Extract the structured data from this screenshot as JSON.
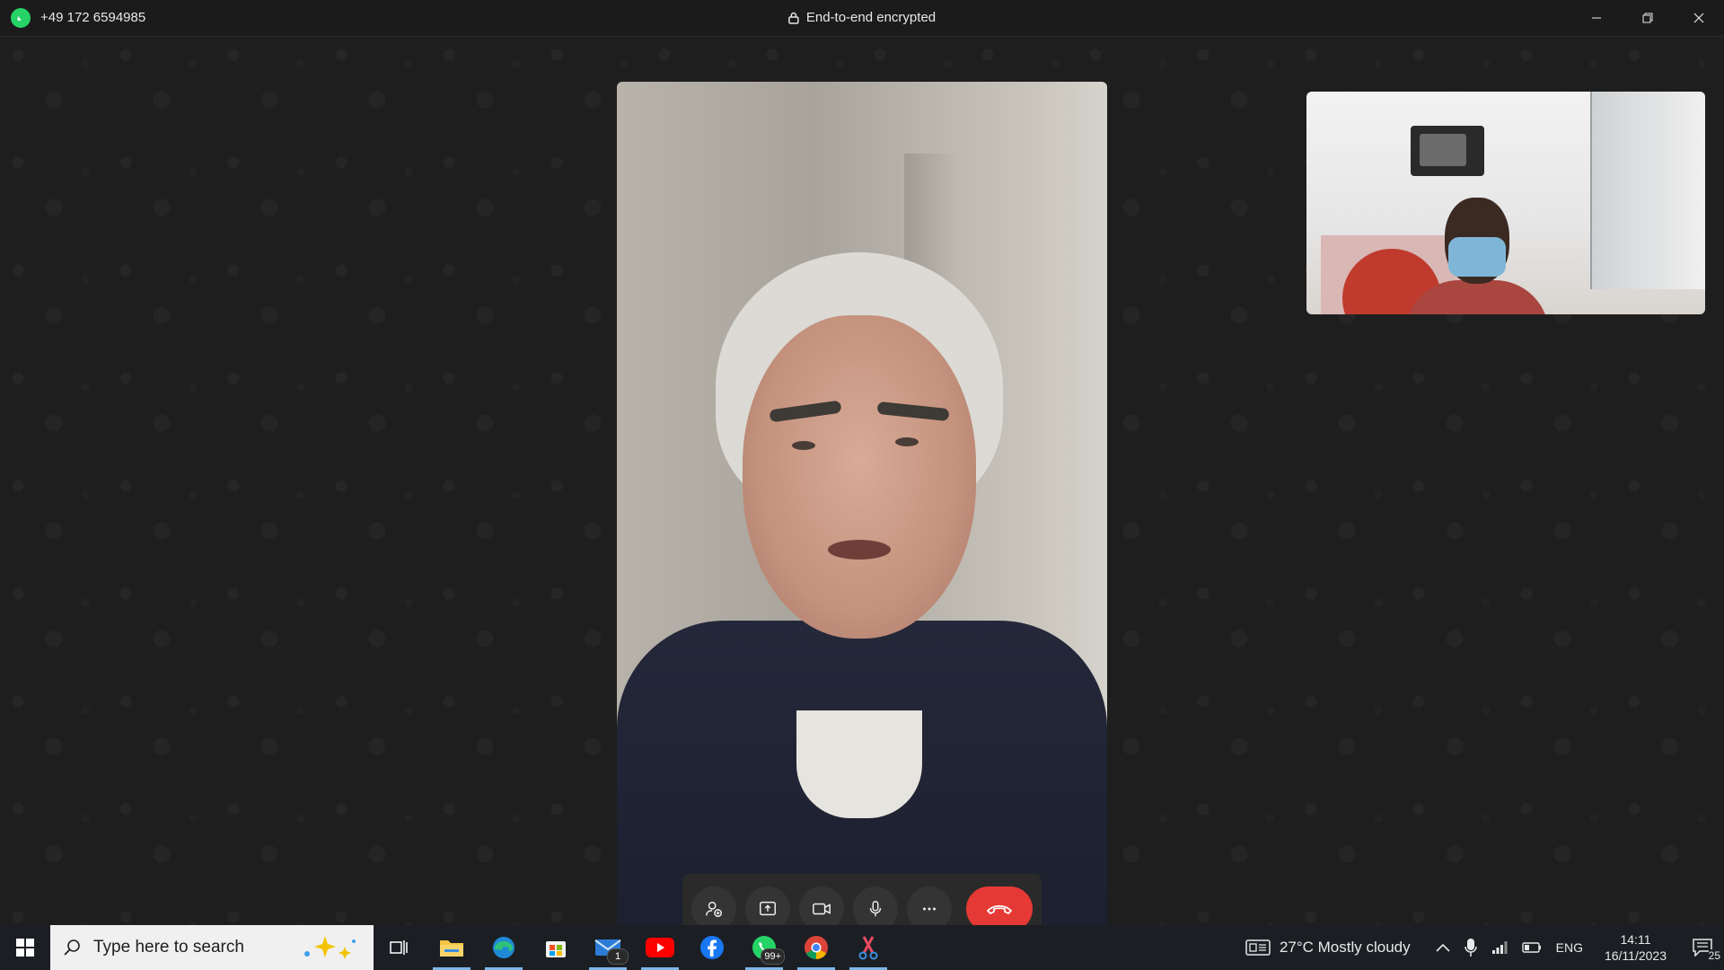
{
  "window": {
    "phone_number": "+49 172 6594985",
    "encryption_label": "End-to-end encrypted"
  },
  "call_controls": {
    "buttons": [
      "add-participant",
      "share-screen",
      "video",
      "microphone",
      "more",
      "end-call"
    ]
  },
  "taskbar": {
    "search_placeholder": "Type here to search",
    "mail_badge": "1",
    "whatsapp_badge": "99+",
    "weather": "27°C  Mostly cloudy",
    "language": "ENG",
    "time": "14:11",
    "date": "16/11/2023",
    "notification_count": "25"
  },
  "colors": {
    "whatsapp_green": "#25d366",
    "end_call_red": "#e53935",
    "taskbar_bg": "#1b1f24"
  }
}
